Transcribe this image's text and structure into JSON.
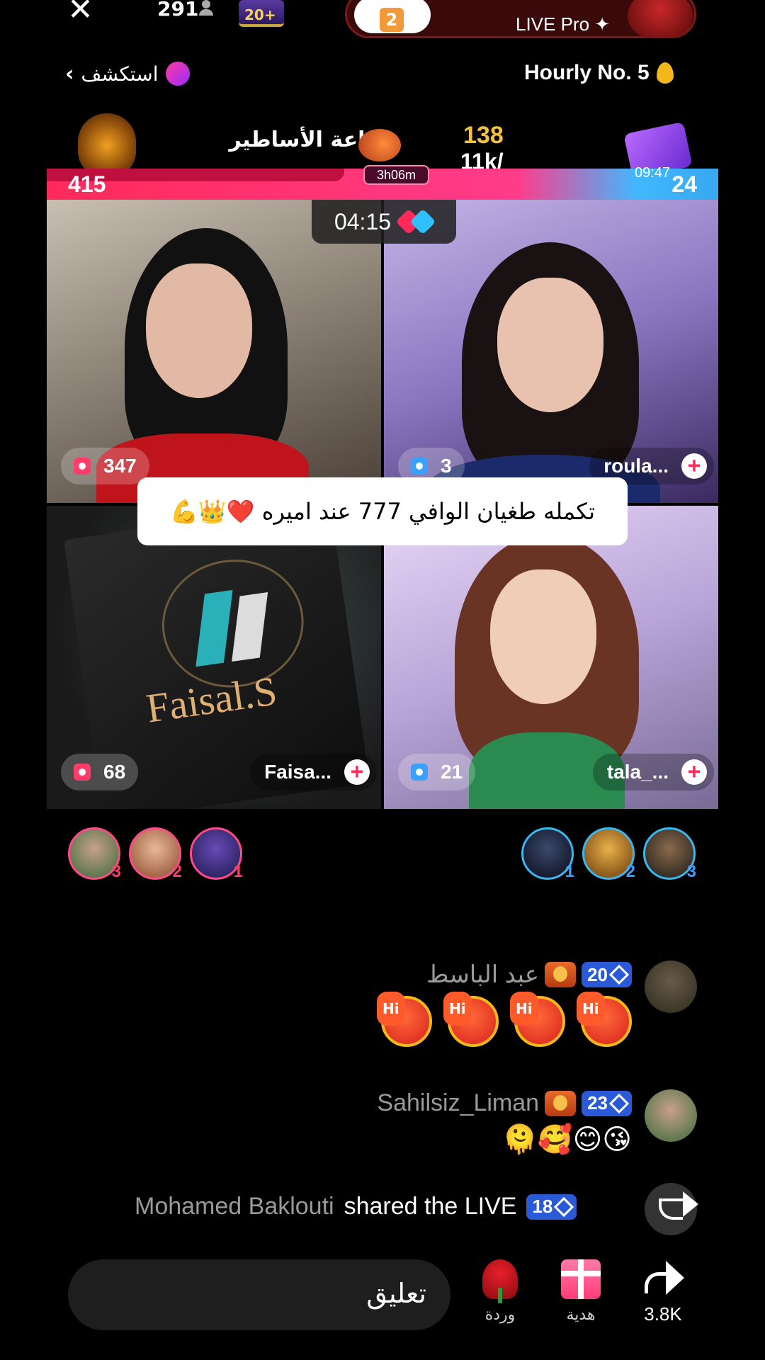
{
  "top": {
    "viewer_count": "291",
    "level_badge": "20+",
    "gift_count": "2",
    "host_label": "LIVE Pro ✦"
  },
  "explore": {
    "label": "استكشف"
  },
  "hourly": {
    "label": "Hourly No. 5"
  },
  "battle": {
    "hall_title": "قاعة الأساطير",
    "score_top": "138",
    "score_bottom": "11k/",
    "left_score": "415",
    "right_score": "24",
    "timer_left": "3h06m",
    "timer_right": "09:47",
    "countdown": "04:15"
  },
  "tiles": {
    "top_left": {
      "count": "347"
    },
    "top_right": {
      "count": "3",
      "name": "roula..."
    },
    "bottom_left": {
      "count": "68",
      "name": "Faisa...",
      "book_text": "Faisal.S"
    },
    "bottom_right": {
      "count": "21",
      "name": "tala_..."
    }
  },
  "pinned_comment": "تكمله طغيان الوافي 777 عند اميره ❤️👑💪",
  "supporters": {
    "left": [
      {
        "rank": "3"
      },
      {
        "rank": "2"
      },
      {
        "rank": "1"
      }
    ],
    "right": [
      {
        "rank": "1"
      },
      {
        "rank": "2"
      },
      {
        "rank": "3"
      }
    ]
  },
  "chat": [
    {
      "user": "عبد الباسط",
      "level": "20",
      "message": ""
    },
    {
      "user": "Sahilsiz_Liman",
      "level": "23",
      "message": "🫠🥰😊😘"
    }
  ],
  "share": {
    "name": "Mohamed Baklouti",
    "text": "shared the LIVE",
    "level": "18"
  },
  "bottom": {
    "comment_placeholder": "تعليق",
    "rose_label": "وردة",
    "gift_label": "هدية",
    "share_count": "3.8K"
  }
}
